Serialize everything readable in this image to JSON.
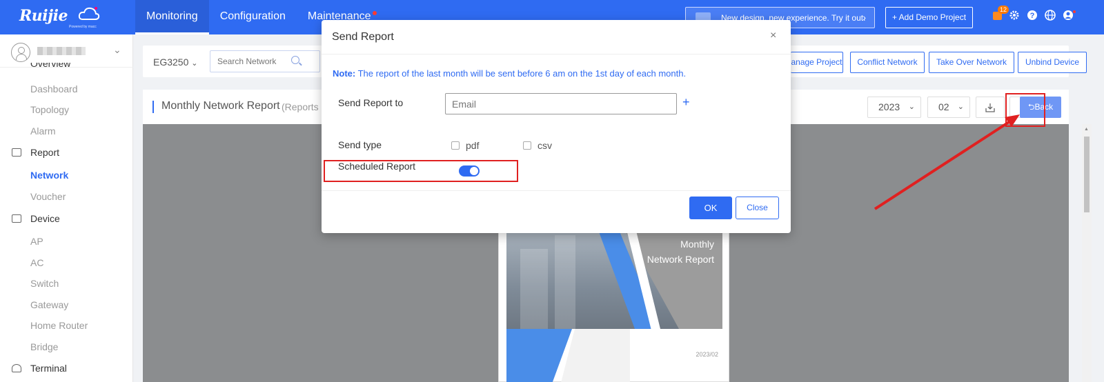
{
  "header": {
    "brand": "Ruijie",
    "powered": "Powered by macc",
    "nav": [
      {
        "label": "Monitoring"
      },
      {
        "label": "Configuration"
      },
      {
        "label": "Maintenance"
      }
    ],
    "promo_text": "New design, new experience. Try it out.",
    "add_demo_label": "+ Add Demo Project",
    "notification_count": "12"
  },
  "sidebar": {
    "overview_label": "Overview",
    "items": [
      {
        "label": "Dashboard"
      },
      {
        "label": "Topology"
      },
      {
        "label": "Alarm"
      },
      {
        "label": "Report"
      },
      {
        "label": "Network"
      },
      {
        "label": "Voucher"
      },
      {
        "label": "Device"
      },
      {
        "label": "AP"
      },
      {
        "label": "AC"
      },
      {
        "label": "Switch"
      },
      {
        "label": "Gateway"
      },
      {
        "label": "Home Router"
      },
      {
        "label": "Bridge"
      },
      {
        "label": "Terminal"
      }
    ]
  },
  "filterbar": {
    "model": "EG3250",
    "search_placeholder": "Search Network",
    "buttons": [
      "anage Project",
      "Conflict Network",
      "Take Over Network",
      "Unbind Device"
    ]
  },
  "report": {
    "title": "Monthly Network Report",
    "subtitle": "(Reports",
    "year": "2023",
    "month": "02",
    "back_label": "⮌Back",
    "cover_title_1": "Monthly",
    "cover_title_2": "Network Report",
    "cover_date": "2023/02"
  },
  "modal": {
    "title": "Send Report",
    "close_icon": "×",
    "note_label": "Note:",
    "note_text": " The report of the last month will be sent before 6 am on the 1st day of each month.",
    "send_to_label": "Send Report to",
    "email_placeholder": "Email",
    "send_type_label": "Send type",
    "pdf_label": "pdf",
    "csv_label": "csv",
    "scheduled_label": "Scheduled Report",
    "scheduled_on": true,
    "ok_label": "OK",
    "close_label": "Close"
  },
  "colors": {
    "accent": "#2f6bf2",
    "annotation": "#e02020"
  }
}
